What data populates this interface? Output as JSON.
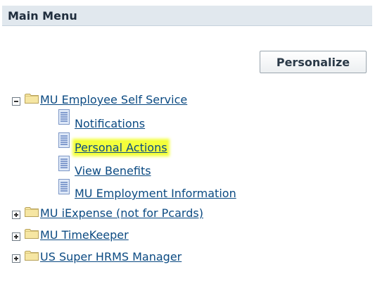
{
  "menu": {
    "title": "Main Menu",
    "personalize_label": "Personalize",
    "items": [
      {
        "label": "MU Employee Self Service",
        "state": "expanded",
        "children": [
          "Notifications",
          "Personal Actions",
          "View Benefits",
          "MU Employment Information"
        ]
      },
      {
        "label": "MU iExpense (not for Pcards)",
        "state": "collapsed"
      },
      {
        "label": "MU TimeKeeper",
        "state": "collapsed"
      },
      {
        "label": "US Super HRMS Manager",
        "state": "collapsed"
      }
    ]
  },
  "highlight_color": "#f3ff3b",
  "link_color": "#0b4a82"
}
